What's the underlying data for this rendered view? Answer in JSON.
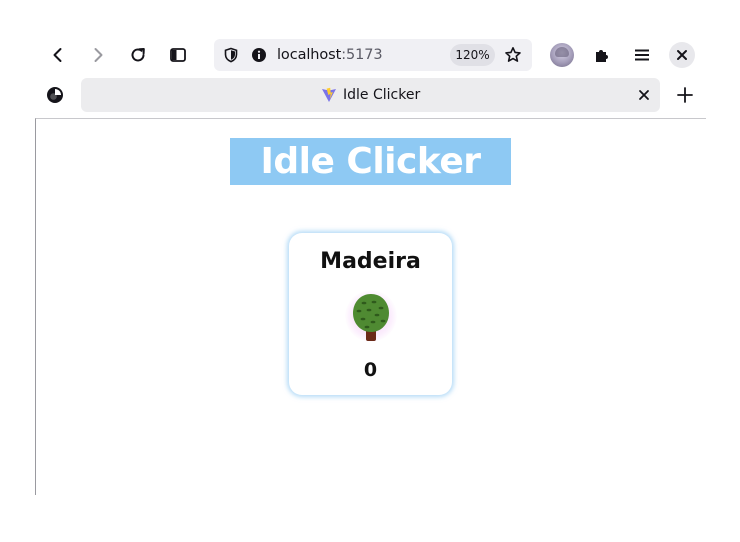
{
  "browser": {
    "url_host": "localhost",
    "url_port": ":5173",
    "zoom": "120%",
    "tab_title": "Idle Clicker"
  },
  "page": {
    "title": "Idle Clicker",
    "resources": [
      {
        "name": "Madeira",
        "icon": "tree-icon",
        "count": "0"
      }
    ]
  },
  "colors": {
    "title_bg": "#8ec9f3",
    "card_glow": "#78bef0"
  }
}
